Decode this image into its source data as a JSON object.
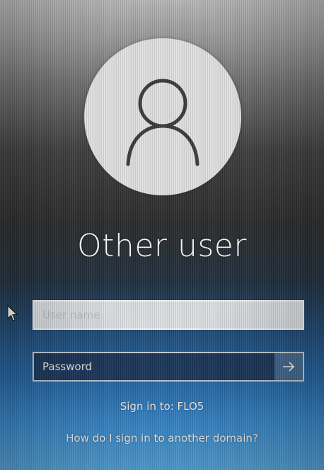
{
  "profile": {
    "avatar_icon": "user-silhouette-icon",
    "display_name": "Other user"
  },
  "login": {
    "username_placeholder": "User name",
    "username_value": "",
    "password_placeholder": "Password",
    "password_value": "",
    "submit_icon": "arrow-right-icon"
  },
  "sign_in_target": "Sign in to: FLO5",
  "help_link": "How do I sign in to another domain?",
  "colors": {
    "avatar_bg": "#e2e2e2",
    "avatar_stroke": "#3a3a3a",
    "text": "#ffffff",
    "accent_blue": "#2367a7"
  }
}
